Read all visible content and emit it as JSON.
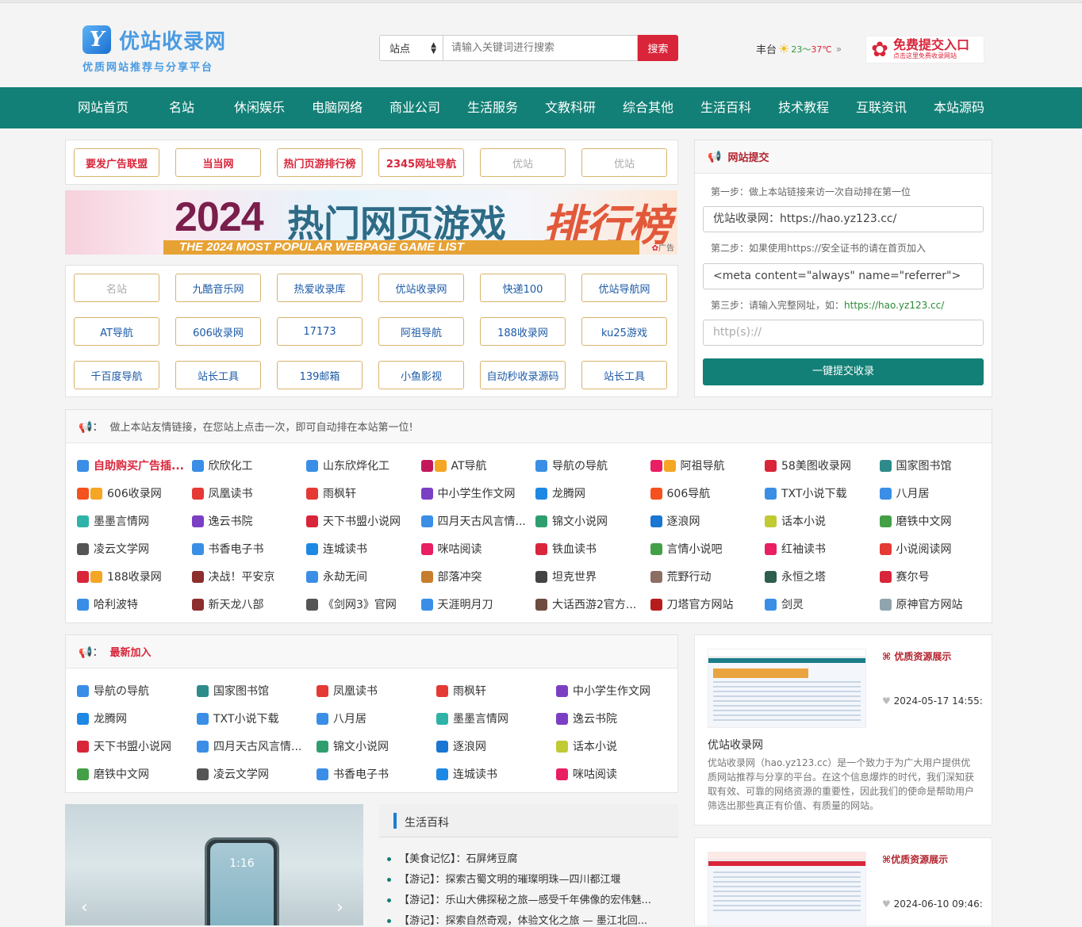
{
  "header": {
    "logo_title": "优站收录网",
    "logo_slogan": "优质网站推荐与分享平台",
    "search_type": "站点",
    "search_placeholder": "请输入关键词进行搜索",
    "search_button": "搜索",
    "weather_city": "丰台",
    "weather_low": "23",
    "weather_sep": "～",
    "weather_high": "37℃",
    "weather_more": "»",
    "submit_ad_title": "免费提交入口",
    "submit_ad_sub": "点击这里免费收录网站"
  },
  "nav": [
    "网站首页",
    "名站",
    "休闲娱乐",
    "电脑网络",
    "商业公司",
    "生活服务",
    "文教科研",
    "综合其他",
    "生活百科",
    "技术教程",
    "互联资讯",
    "本站源码"
  ],
  "top_buttons": [
    {
      "label": "要发广告联盟",
      "style": "red"
    },
    {
      "label": "当当网",
      "style": "red"
    },
    {
      "label": "热门页游排行榜",
      "style": "red"
    },
    {
      "label": "2345网址导航",
      "style": "red"
    },
    {
      "label": "优站",
      "style": "grey"
    },
    {
      "label": "优站",
      "style": "grey"
    }
  ],
  "banner": {
    "year": "2024",
    "title": "热门网页游戏",
    "rank": "排行榜",
    "subtitle": "THE 2024 MOST POPULAR WEBPAGE GAME LIST",
    "ad_mark": "广告"
  },
  "site_buttons": [
    {
      "label": "名站",
      "style": "grey"
    },
    {
      "label": "九酷音乐网",
      "style": "blue"
    },
    {
      "label": "热爱收录库",
      "style": "blue"
    },
    {
      "label": "优站收录网",
      "style": "blue"
    },
    {
      "label": "快递100",
      "style": "blue"
    },
    {
      "label": "优站导航网",
      "style": "blue"
    },
    {
      "label": "AT导航",
      "style": "blue"
    },
    {
      "label": "606收录网",
      "style": "blue"
    },
    {
      "label": "17173",
      "style": "blue"
    },
    {
      "label": "阿祖导航",
      "style": "blue"
    },
    {
      "label": "188收录网",
      "style": "blue"
    },
    {
      "label": "ku25游戏",
      "style": "blue"
    },
    {
      "label": "千百度导航",
      "style": "blue"
    },
    {
      "label": "站长工具",
      "style": "blue"
    },
    {
      "label": "139邮箱",
      "style": "blue"
    },
    {
      "label": "小鱼影视",
      "style": "blue"
    },
    {
      "label": "自动秒收录源码",
      "style": "blue"
    },
    {
      "label": "站长工具",
      "style": "blue"
    }
  ],
  "submit_panel": {
    "title": "网站提交",
    "step1": "第一步：做上本站链接来访一次自动排在第一位",
    "field1": "优站收录网：https://hao.yz123.cc/",
    "step2": "第二步：如果使用https://安全证书的请在首页加入",
    "field2": "<meta content=\"always\" name=\"referrer\">",
    "step3_prefix": "第三步：请输入完整网址，如：",
    "step3_example": "https://hao.yz123.cc/",
    "field3_placeholder": "http(s)://",
    "button": "一键提交收录"
  },
  "friend_links": {
    "notice": "做上本站友情链接，在您站上点击一次，即可自动排在本站第一位!",
    "items": [
      {
        "label": "自助购买广告插...",
        "icon_color": "#3a8ee6",
        "highlight": true
      },
      {
        "label": "欣欣化工",
        "icon_color": "#3a8ee6"
      },
      {
        "label": "山东欣烨化工",
        "icon_color": "#3a8ee6"
      },
      {
        "label": "AT导航",
        "icon_color": "#c2185b",
        "badge": true
      },
      {
        "label": "导航の导航",
        "icon_color": "#3a8ee6"
      },
      {
        "label": "阿祖导航",
        "icon_color": "#e91e63",
        "badge": true
      },
      {
        "label": "58美图收录网",
        "icon_color": "#d9253a"
      },
      {
        "label": "国家图书馆",
        "icon_color": "#2e8b8b"
      },
      {
        "label": "606收录网",
        "icon_color": "#f4511e",
        "badge": true
      },
      {
        "label": "凤凰读书",
        "icon_color": "#e53935"
      },
      {
        "label": "雨枫轩",
        "icon_color": "#e53935"
      },
      {
        "label": "中小学生作文网",
        "icon_color": "#7b3fc4"
      },
      {
        "label": "龙腾网",
        "icon_color": "#1e88e5"
      },
      {
        "label": "606导航",
        "icon_color": "#f4511e"
      },
      {
        "label": "TXT小说下载",
        "icon_color": "#3a8ee6"
      },
      {
        "label": "八月居",
        "icon_color": "#3a8ee6"
      },
      {
        "label": "墨墨言情网",
        "icon_color": "#2fb3a8"
      },
      {
        "label": "逸云书院",
        "icon_color": "#7b3fc4"
      },
      {
        "label": "天下书盟小说网",
        "icon_color": "#d9253a"
      },
      {
        "label": "四月天古风言情...",
        "icon_color": "#3a8ee6"
      },
      {
        "label": "锦文小说网",
        "icon_color": "#2e9e6e"
      },
      {
        "label": "逐浪网",
        "icon_color": "#1976d2"
      },
      {
        "label": "话本小说",
        "icon_color": "#c0ca33"
      },
      {
        "label": "磨铁中文网",
        "icon_color": "#43a047"
      },
      {
        "label": "凌云文学网",
        "icon_color": "#555555"
      },
      {
        "label": "书香电子书",
        "icon_color": "#3a8ee6"
      },
      {
        "label": "连城读书",
        "icon_color": "#1e88e5"
      },
      {
        "label": "咪咕阅读",
        "icon_color": "#e91e63"
      },
      {
        "label": "铁血读书",
        "icon_color": "#d9253a"
      },
      {
        "label": "言情小说吧",
        "icon_color": "#43a047"
      },
      {
        "label": "红袖读书",
        "icon_color": "#e91e63"
      },
      {
        "label": "小说阅读网",
        "icon_color": "#e53935"
      },
      {
        "label": "188收录网",
        "icon_color": "#d9253a",
        "badge": true
      },
      {
        "label": "决战！平安京",
        "icon_color": "#8d2e2e"
      },
      {
        "label": "永劫无间",
        "icon_color": "#3a8ee6"
      },
      {
        "label": "部落冲突",
        "icon_color": "#c77d2e"
      },
      {
        "label": "坦克世界",
        "icon_color": "#444444"
      },
      {
        "label": "荒野行动",
        "icon_color": "#8d6e63"
      },
      {
        "label": "永恒之塔",
        "icon_color": "#2e5e4e"
      },
      {
        "label": "赛尔号",
        "icon_color": "#d9253a"
      },
      {
        "label": "哈利波特",
        "icon_color": "#3a8ee6"
      },
      {
        "label": "新天龙八部",
        "icon_color": "#8d2e2e"
      },
      {
        "label": "《剑网3》官网",
        "icon_color": "#555555"
      },
      {
        "label": "天涯明月刀",
        "icon_color": "#3a8ee6"
      },
      {
        "label": "大话西游2官方...",
        "icon_color": "#6d4c41"
      },
      {
        "label": "刀塔官方网站",
        "icon_color": "#b71c1c"
      },
      {
        "label": "剑灵",
        "icon_color": "#3a8ee6"
      },
      {
        "label": "原神官方网站",
        "icon_color": "#90a4ae"
      }
    ]
  },
  "latest": {
    "title": "最新加入",
    "items": [
      {
        "label": "导航の导航",
        "icon_color": "#3a8ee6"
      },
      {
        "label": "国家图书馆",
        "icon_color": "#2e8b8b"
      },
      {
        "label": "凤凰读书",
        "icon_color": "#e53935"
      },
      {
        "label": "雨枫轩",
        "icon_color": "#e53935"
      },
      {
        "label": "中小学生作文网",
        "icon_color": "#7b3fc4"
      },
      {
        "label": "龙腾网",
        "icon_color": "#1e88e5"
      },
      {
        "label": "TXT小说下载",
        "icon_color": "#3a8ee6"
      },
      {
        "label": "八月居",
        "icon_color": "#3a8ee6"
      },
      {
        "label": "墨墨言情网",
        "icon_color": "#2fb3a8"
      },
      {
        "label": "逸云书院",
        "icon_color": "#7b3fc4"
      },
      {
        "label": "天下书盟小说网",
        "icon_color": "#d9253a"
      },
      {
        "label": "四月天古风言情...",
        "icon_color": "#3a8ee6"
      },
      {
        "label": "锦文小说网",
        "icon_color": "#2e9e6e"
      },
      {
        "label": "逐浪网",
        "icon_color": "#1976d2"
      },
      {
        "label": "话本小说",
        "icon_color": "#c0ca33"
      },
      {
        "label": "磨铁中文网",
        "icon_color": "#43a047"
      },
      {
        "label": "凌云文学网",
        "icon_color": "#555555"
      },
      {
        "label": "书香电子书",
        "icon_color": "#3a8ee6"
      },
      {
        "label": "连城读书",
        "icon_color": "#1e88e5"
      },
      {
        "label": "咪咕阅读",
        "icon_color": "#e91e63"
      }
    ]
  },
  "showcase": [
    {
      "title": "优质资源展示",
      "date": "2024-05-17 14:55:",
      "name": "优站收录网",
      "desc": "优站收录网（hao.yz123.cc）是一个致力于为广大用户提供优质网站推荐与分享的平台。在这个信息爆炸的时代，我们深知获取有效、可靠的网络资源的重要性，因此我们的使命是帮助用户筛选出那些真正有价值、有质量的网站。"
    },
    {
      "title": "优质资源展示",
      "date": "2024-06-10 09:46:"
    }
  ],
  "carousel": {
    "time": "1:16",
    "prev": "‹",
    "next": "›"
  },
  "life": {
    "title": "生活百科",
    "items": [
      "【美食记忆】：石屏烤豆腐",
      "【游记】：探索古蜀文明的璀璨明珠—四川都江堰",
      "【游记】：乐山大佛探秘之旅—感受千年佛像的宏伟魅...",
      "【游记】：探索自然奇观，体验文化之旅 — 墨江北回..."
    ]
  }
}
